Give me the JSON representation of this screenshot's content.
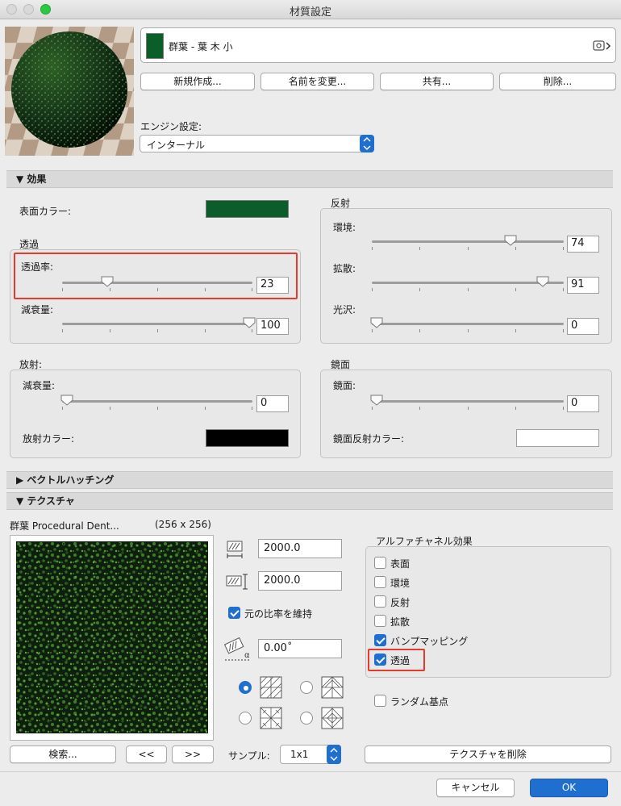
{
  "window": {
    "title": "材質設定"
  },
  "material": {
    "name": "群葉 - 葉 木 小",
    "swatch_color": "#0b5e2a"
  },
  "actions": {
    "new": "新規作成...",
    "rename": "名前を変更...",
    "share": "共有...",
    "delete": "削除..."
  },
  "engine": {
    "label": "エンジン設定:",
    "value": "インターナル"
  },
  "effects": {
    "header": "効果",
    "surface_color_label": "表面カラー:",
    "surface_color": "#0b5e2a",
    "transparency": {
      "title": "透過",
      "rate_label": "透過率:",
      "rate_value": "23",
      "falloff_label": "減衰量:",
      "falloff_value": "100"
    },
    "reflection": {
      "title": "反射",
      "ambient_label": "環境:",
      "ambient_value": "74",
      "diffuse_label": "拡散:",
      "diffuse_value": "91",
      "shine_label": "光沢:",
      "shine_value": "0"
    },
    "emission": {
      "title": "放射:",
      "falloff_label": "減衰量:",
      "falloff_value": "0",
      "color_label": "放射カラー:",
      "color": "#000000"
    },
    "specular": {
      "title": "鏡面",
      "label": "鏡面:",
      "value": "0",
      "color_label": "鏡面反射カラー:",
      "color": "#ffffff"
    }
  },
  "vector_hatching": {
    "header": "ベクトルハッチング"
  },
  "texture": {
    "header": "テクスチャ",
    "name": "群葉 Procedural Dent...",
    "size": "(256 x 256)",
    "width": "2000.0",
    "height": "2000.0",
    "keep_ratio_label": "元の比率を維持",
    "keep_ratio": true,
    "angle": "0.00˚",
    "search_button": "検索...",
    "prev_button": "<<",
    "next_button": ">>",
    "sample_label": "サンプル:",
    "sample_value": "1x1",
    "delete_button": "テクスチャを削除",
    "alpha": {
      "title": "アルファチャネル効果",
      "items": [
        {
          "label": "表面",
          "checked": false
        },
        {
          "label": "環境",
          "checked": false
        },
        {
          "label": "反射",
          "checked": false
        },
        {
          "label": "拡散",
          "checked": false
        },
        {
          "label": "バンプマッピング",
          "checked": true
        },
        {
          "label": "透過",
          "checked": true
        }
      ],
      "random_origin_label": "ランダム基点",
      "random_origin": false
    }
  },
  "footer": {
    "cancel": "キャンセル",
    "ok": "OK"
  },
  "colors": {
    "accent": "#1f6fd1",
    "highlight": "#e53a2c"
  }
}
